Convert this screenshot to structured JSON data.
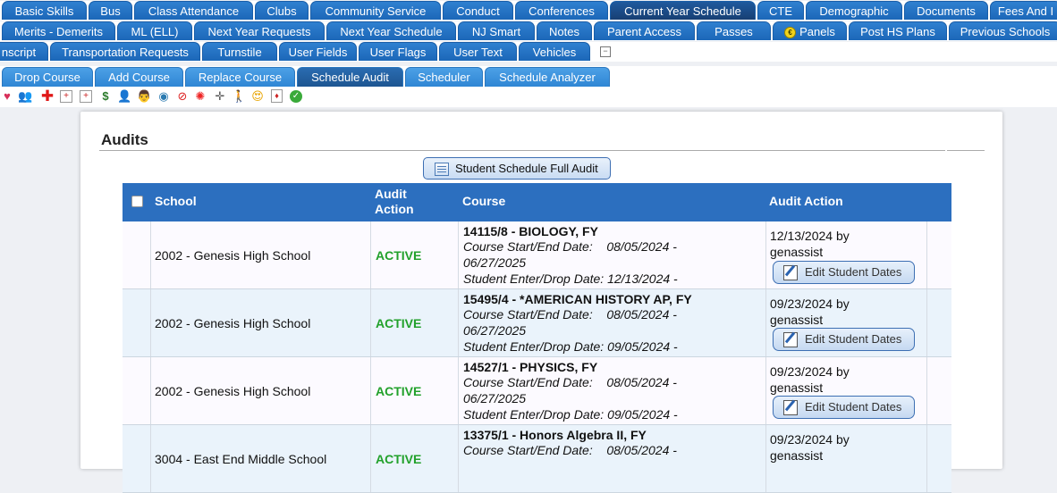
{
  "top_tabs": {
    "row1": [
      "Basic Skills",
      "Bus",
      "Class Attendance",
      "Clubs",
      "Community Service",
      "Conduct",
      "Conferences",
      "Current Year Schedule",
      "CTE",
      "Demographic",
      "Documents",
      "Fees And I"
    ],
    "row2": [
      "Merits - Demerits",
      "ML (ELL)",
      "Next Year Requests",
      "Next Year Schedule",
      "NJ Smart",
      "Notes",
      "Parent Access",
      "Passes",
      "Panels",
      "Post HS Plans",
      "Previous Schools"
    ],
    "row3": [
      "nscript",
      "Transportation Requests",
      "Turnstile",
      "User Fields",
      "User Flags",
      "User Text",
      "Vehicles"
    ],
    "active": "Current Year Schedule",
    "panels_coin": "€"
  },
  "sub_tabs": [
    "Drop Course",
    "Add Course",
    "Replace Course",
    "Schedule Audit",
    "Scheduler",
    "Schedule Analyzer"
  ],
  "sub_tab_active": "Schedule Audit",
  "icon_bar": [
    "heart-icon",
    "people-icon",
    "red-cross-icon",
    "medical-kit-icon",
    "first-aid-icon",
    "money-icon",
    "person-icon",
    "teacher-icon",
    "eye-exam-icon",
    "no-symbol-icon",
    "virus-icon",
    "cross-plus-icon",
    "walking-person-icon",
    "heart-eyes-emoji-icon",
    "playing-card-icon",
    "green-check-icon"
  ],
  "panel": {
    "title": "Audits",
    "full_audit_button": "Student Schedule Full Audit"
  },
  "grid": {
    "headers": {
      "school": "School",
      "audit_action_l1": "Audit",
      "audit_action_l2": "Action",
      "course": "Course",
      "audit_action": "Audit Action"
    },
    "rows": [
      {
        "school": "2002 - Genesis High School",
        "status": "ACTIVE",
        "course": "14115/8 - BIOLOGY, FY",
        "start_end_label": "Course Start/End Date:",
        "start_date": "08/05/2024 -",
        "end_date": "06/27/2025",
        "enter_drop": "Student Enter/Drop Date: 12/13/2024 -",
        "action_date": "12/13/2024 by",
        "action_user": "genassist",
        "edit_label": "Edit Student Dates"
      },
      {
        "school": "2002 - Genesis High School",
        "status": "ACTIVE",
        "course": "15495/4 - *AMERICAN HISTORY AP, FY",
        "start_end_label": "Course Start/End Date:",
        "start_date": "08/05/2024 -",
        "end_date": "06/27/2025",
        "enter_drop": "Student Enter/Drop Date: 09/05/2024 -",
        "action_date": "09/23/2024 by",
        "action_user": "genassist",
        "edit_label": "Edit Student Dates"
      },
      {
        "school": "2002 - Genesis High School",
        "status": "ACTIVE",
        "course": "14527/1 - PHYSICS, FY",
        "start_end_label": "Course Start/End Date:",
        "start_date": "08/05/2024 -",
        "end_date": "06/27/2025",
        "enter_drop": "Student Enter/Drop Date: 09/05/2024 -",
        "action_date": "09/23/2024 by",
        "action_user": "genassist",
        "edit_label": "Edit Student Dates"
      },
      {
        "school": "3004 - East End Middle School",
        "status": "ACTIVE",
        "course": "13375/1 - Honors Algebra II, FY",
        "start_end_label": "Course Start/End Date:",
        "start_date": "08/05/2024 -",
        "end_date": "",
        "enter_drop": "",
        "action_date": "09/23/2024 by",
        "action_user": "genassist",
        "edit_label": ""
      }
    ]
  },
  "colors": {
    "tab_blue": "#1c67b8",
    "tab_active": "#173f73",
    "header_blue": "#2c6fbf",
    "active_green": "#22a12b"
  }
}
